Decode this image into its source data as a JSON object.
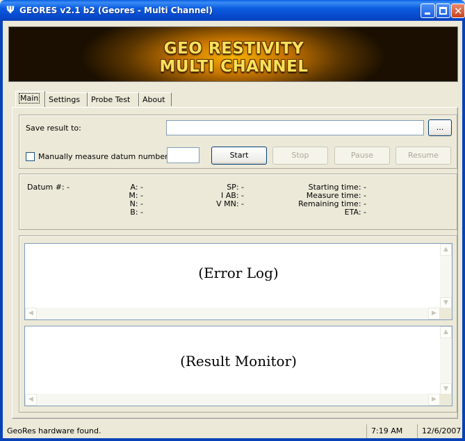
{
  "window": {
    "title": "GEORES v2.1 b2 (Geores - Multi Channel)",
    "icon": "app-icon",
    "controls": [
      "minimize-icon",
      "maximize-icon",
      "close-icon"
    ]
  },
  "banner": {
    "line1": "GEO RESTIVITY",
    "line2": "MULTI CHANNEL"
  },
  "tabs": [
    {
      "label": "Main",
      "active": true
    },
    {
      "label": "Settings",
      "active": false
    },
    {
      "label": "Probe Test",
      "active": false
    },
    {
      "label": "About",
      "active": false
    }
  ],
  "save": {
    "label": "Save result to:",
    "value": "",
    "browse_label": "..."
  },
  "manual": {
    "label": "Manually measure datum number:",
    "checked": false,
    "value": ""
  },
  "buttons": {
    "start": "Start",
    "stop": "Stop",
    "pause": "Pause",
    "resume": "Resume"
  },
  "info": {
    "datum": "Datum #:  -",
    "a": "A:  -",
    "m": "M:  -",
    "n": "N:  -",
    "b": "B:  -",
    "sp": "SP:  -",
    "iab": "I AB:  -",
    "vmn": "V MN:  -",
    "starting_time": "Starting time:  -",
    "measure_time": "Measure time:  -",
    "remaining_time": "Remaining time:  -",
    "eta": "ETA:  -"
  },
  "error_log": {
    "label": "(Error Log)"
  },
  "result_monitor": {
    "label": "(Result Monitor)"
  },
  "statusbar": {
    "message": "GeoRes hardware found.",
    "time": "7:19 AM",
    "date": "12/6/2007"
  },
  "colors": {
    "titlebar": "#0a5fe2",
    "face": "#ece9d8",
    "banner_text": "#f8e15a"
  }
}
